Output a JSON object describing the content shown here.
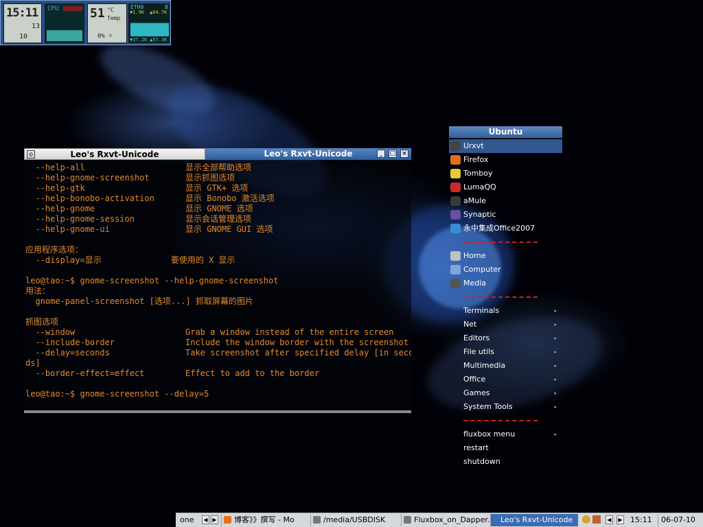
{
  "dock": {
    "clock": {
      "time": "15:11",
      "day": "13",
      "month": "10"
    },
    "cpu": {
      "label": "CPU"
    },
    "temp": {
      "value": "51",
      "unit": "°C",
      "label": "Temp",
      "fan": "0% ☼"
    },
    "net": {
      "iface": "ETH0",
      "in_top": "▼1.9K",
      "out_top": "▲64.7K",
      "in_bot": "▼37.2K",
      "out_bot": "▲57.3K",
      "count": "8"
    }
  },
  "terminal": {
    "title_inactive": "Leo's Rxvt-Unicode",
    "title_active": "Leo's Rxvt-Unicode",
    "lines": [
      {
        "a": "  --help-all",
        "b": "显示全部帮助选项"
      },
      {
        "a": "  --help-gnome-screenshot",
        "b": "显示抓图选项"
      },
      {
        "a": "  --help-gtk",
        "b": "显示 GTK+ 选项"
      },
      {
        "a": "  --help-bonobo-activation",
        "b": "显示 Bonobo 激活选项"
      },
      {
        "a": "  --help-gnome",
        "b": "显示 GNOME 选项"
      },
      {
        "a": "  --help-gnome-session",
        "b": "显示会话管理选项"
      },
      {
        "a": "  --help-gnome-ui",
        "b": "显示 GNOME GUI 选项"
      },
      {
        "a": "",
        "b": ""
      },
      {
        "a": "应用程序选项：",
        "b": ""
      },
      {
        "a": "  --display=显示              要使用的 X 显示",
        "b": ""
      },
      {
        "a": "",
        "b": ""
      },
      {
        "a": "leo@tao:~$ gnome-screenshot --help-gnome-screenshot",
        "b": ""
      },
      {
        "a": "用法：",
        "b": ""
      },
      {
        "a": "  gnome-panel-screenshot [选项...] 抓取屏幕的图片",
        "b": ""
      },
      {
        "a": "",
        "b": ""
      },
      {
        "a": "抓图选项",
        "b": ""
      },
      {
        "a": "  --window",
        "b": "Grab a window instead of the entire screen"
      },
      {
        "a": "  --include-border",
        "b": "Include the window border with the screenshot"
      },
      {
        "a": "  --delay=seconds",
        "b": "Take screenshot after specified delay [in secon"
      },
      {
        "a": "ds]",
        "b": ""
      },
      {
        "a": "  --border-effect=effect",
        "b": "Effect to add to the border"
      },
      {
        "a": "",
        "b": ""
      },
      {
        "a": "leo@tao:~$ gnome-screenshot --delay=5",
        "b": ""
      }
    ]
  },
  "menu": {
    "title": "Ubuntu",
    "apps": [
      {
        "label": "Urxvt",
        "icon": "terminal-icon",
        "color": "#444444"
      },
      {
        "label": "Firefox",
        "icon": "firefox-icon",
        "color": "#e2701a"
      },
      {
        "label": "Tomboy",
        "icon": "tomboy-icon",
        "color": "#e8c93a"
      },
      {
        "label": "LumaQQ",
        "icon": "penguin-icon",
        "color": "#cc2a2a"
      },
      {
        "label": "aMule",
        "icon": "amule-icon",
        "color": "#3a3a3a"
      },
      {
        "label": "Synaptic",
        "icon": "synaptic-icon",
        "color": "#6a4fa0"
      },
      {
        "label": "永中集成Office2007",
        "icon": "office-icon",
        "color": "#3c8cd0"
      }
    ],
    "places": [
      {
        "label": "Home",
        "icon": "home-icon",
        "color": "#c0c0c0"
      },
      {
        "label": "Computer",
        "icon": "computer-icon",
        "color": "#7ea6d8"
      },
      {
        "label": "Media",
        "icon": "media-icon",
        "color": "#555555"
      }
    ],
    "submenus": [
      "Terminals",
      "Net",
      "Editors",
      "File utils",
      "Multimedia",
      "Office",
      "Games",
      "System Tools"
    ],
    "system": [
      "fluxbox menu",
      "restart",
      "shutdown"
    ]
  },
  "taskbar": {
    "workspace": "one",
    "tasks": [
      "博客》》撰写 - Mo",
      "/media/USBDISK",
      "Fluxbox_on_Dapper.",
      "Leo's Rxvt-Unicode"
    ],
    "clock": "15:11",
    "date": "06-07-10"
  }
}
